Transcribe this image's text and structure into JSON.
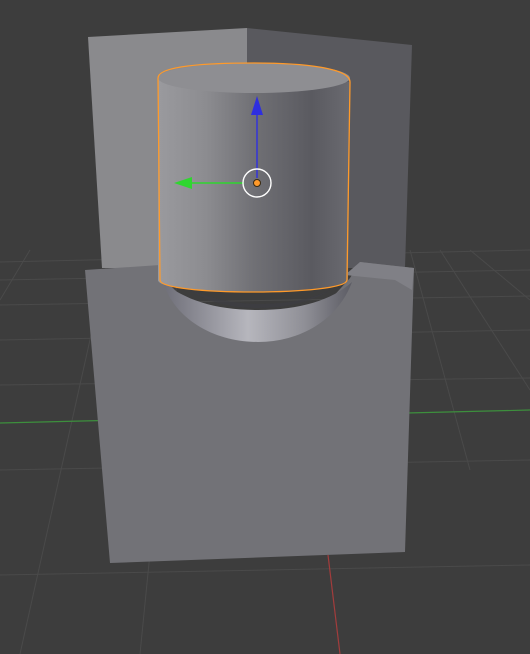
{
  "viewport": {
    "background": "#3d3d3d",
    "grid_color": "#4a4a4a",
    "x_axis_color": "#a23c3c",
    "y_axis_color": "#3d8f3d"
  },
  "scene": {
    "back_block_color": "#8a8a8d",
    "front_block_color": "#747478",
    "cylinder_outline_color": "#ff9a2a"
  },
  "gizmo": {
    "z_arrow_color": "#2f2fe0",
    "y_arrow_color": "#2fd62f",
    "pivot_color": "#ff9a2a",
    "pivot_ring_color": "#ffffff",
    "icons": [
      "move-z-arrow-icon",
      "move-y-arrow-icon",
      "pivot-origin-icon"
    ]
  }
}
